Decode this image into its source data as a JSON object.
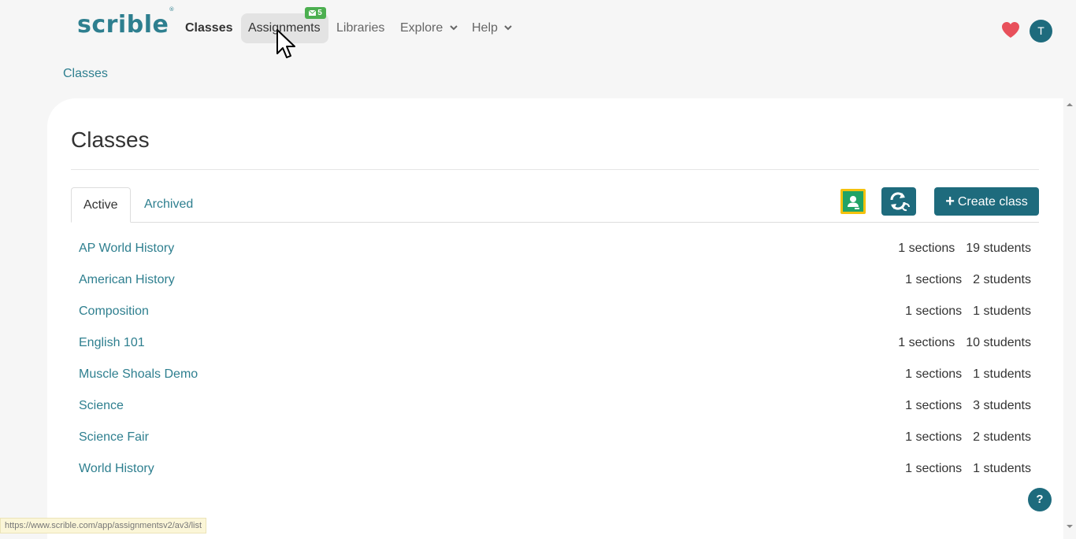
{
  "brand": {
    "logo_text": "scrible",
    "logo_mark": "®"
  },
  "nav": {
    "items": [
      {
        "label": "Classes"
      },
      {
        "label": "Assignments",
        "badge": "5"
      },
      {
        "label": "Libraries"
      },
      {
        "label": "Explore"
      },
      {
        "label": "Help"
      }
    ],
    "avatar_initial": "T"
  },
  "breadcrumb": {
    "label": "Classes"
  },
  "page": {
    "title": "Classes"
  },
  "tabs": [
    {
      "label": "Active"
    },
    {
      "label": "Archived"
    }
  ],
  "actions": {
    "create_label": "Create class"
  },
  "classes": [
    {
      "name": "AP World History",
      "sections": "1 sections",
      "students": "19 students"
    },
    {
      "name": "American History",
      "sections": "1 sections",
      "students": "2 students"
    },
    {
      "name": "Composition",
      "sections": "1 sections",
      "students": "1 students"
    },
    {
      "name": "English 101",
      "sections": "1 sections",
      "students": "10 students"
    },
    {
      "name": "Muscle Shoals Demo",
      "sections": "1 sections",
      "students": "1 students"
    },
    {
      "name": "Science",
      "sections": "1 sections",
      "students": "3 students"
    },
    {
      "name": "Science Fair",
      "sections": "1 sections",
      "students": "2 students"
    },
    {
      "name": "World History",
      "sections": "1 sections",
      "students": "1 students"
    }
  ],
  "help": {
    "label": "?"
  },
  "status_bar": {
    "url": "https://www.scrible.com/app/assignmentsv2/av3/list"
  },
  "colors": {
    "accent": "#1e6b7d",
    "link": "#2e7f8f",
    "badge": "#4caf50",
    "heart": "#e8505b",
    "classroom_border": "#f4c20d",
    "classroom_fill": "#22a366"
  }
}
